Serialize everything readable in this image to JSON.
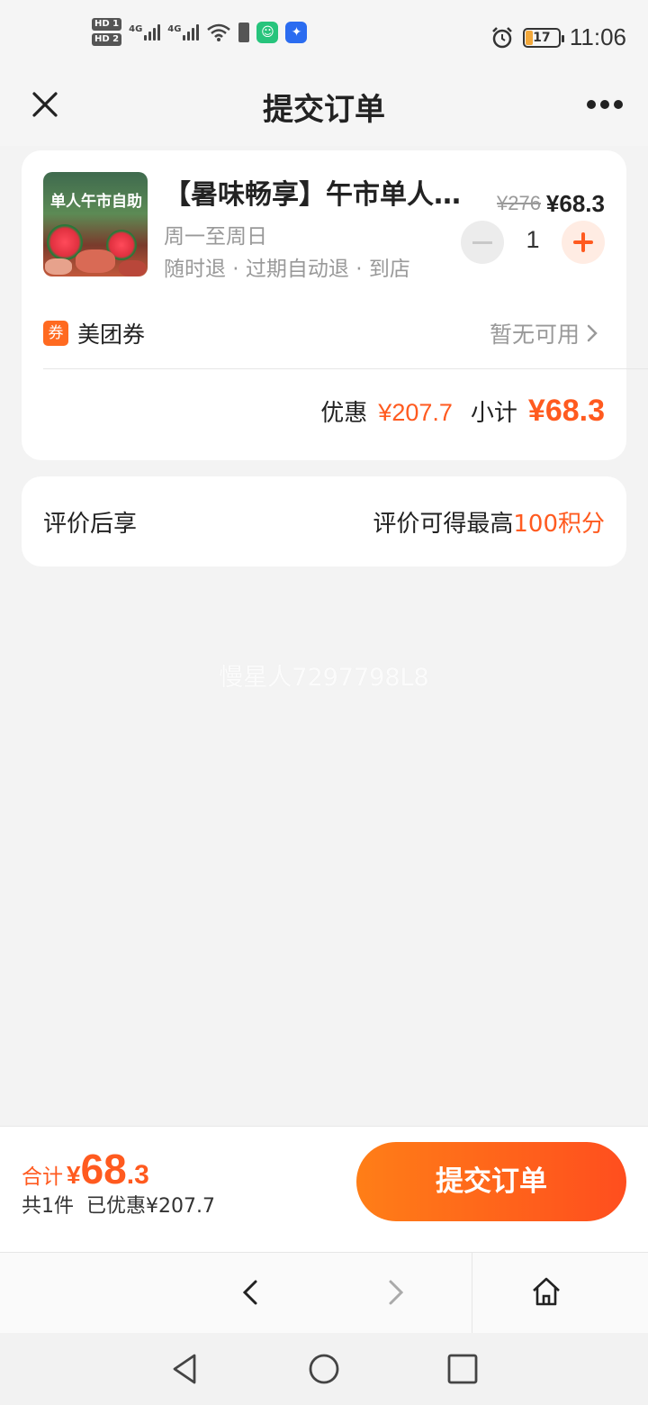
{
  "status_bar": {
    "hd1": "HD 1",
    "hd2": "HD 2",
    "net1": "4G",
    "net2": "4G",
    "battery_level": "17",
    "time": "11:06",
    "icons": [
      "signal-icon",
      "wifi-icon",
      "battery-warning-icon",
      "app-notification-icon",
      "bulb-notification-icon",
      "alarm-icon",
      "battery-icon"
    ]
  },
  "header": {
    "title": "提交订单"
  },
  "product": {
    "thumb_title": "单人午市自助",
    "name": "【暑味畅享】午市单人自助",
    "days": "周一至周日",
    "policy": "随时退 · 过期自动退 · 到店",
    "original_price": "¥276",
    "price": "¥68.3",
    "quantity": "1"
  },
  "coupon": {
    "icon_text": "券",
    "label": "美团券",
    "status": "暂无可用"
  },
  "summary": {
    "discount_label": "优惠",
    "discount_value": "¥207.7",
    "subtotal_label": "小计",
    "subtotal_value": "¥68.3"
  },
  "review": {
    "left": "评价后享",
    "right_prefix": "评价可得最高",
    "right_points": "100积分"
  },
  "watermark": "慢星人7297798L8",
  "footer": {
    "total_label": "合计",
    "total_yen": "¥",
    "total_int": "68",
    "total_dec": ".3",
    "count": "共1件",
    "saved": "已优惠¥207.7",
    "submit_label": "提交订单"
  },
  "colors": {
    "accent": "#ff5a1f",
    "button_gradient_start": "#ff7e17",
    "button_gradient_end": "#ff4e1e",
    "background": "#f3f3f3"
  }
}
